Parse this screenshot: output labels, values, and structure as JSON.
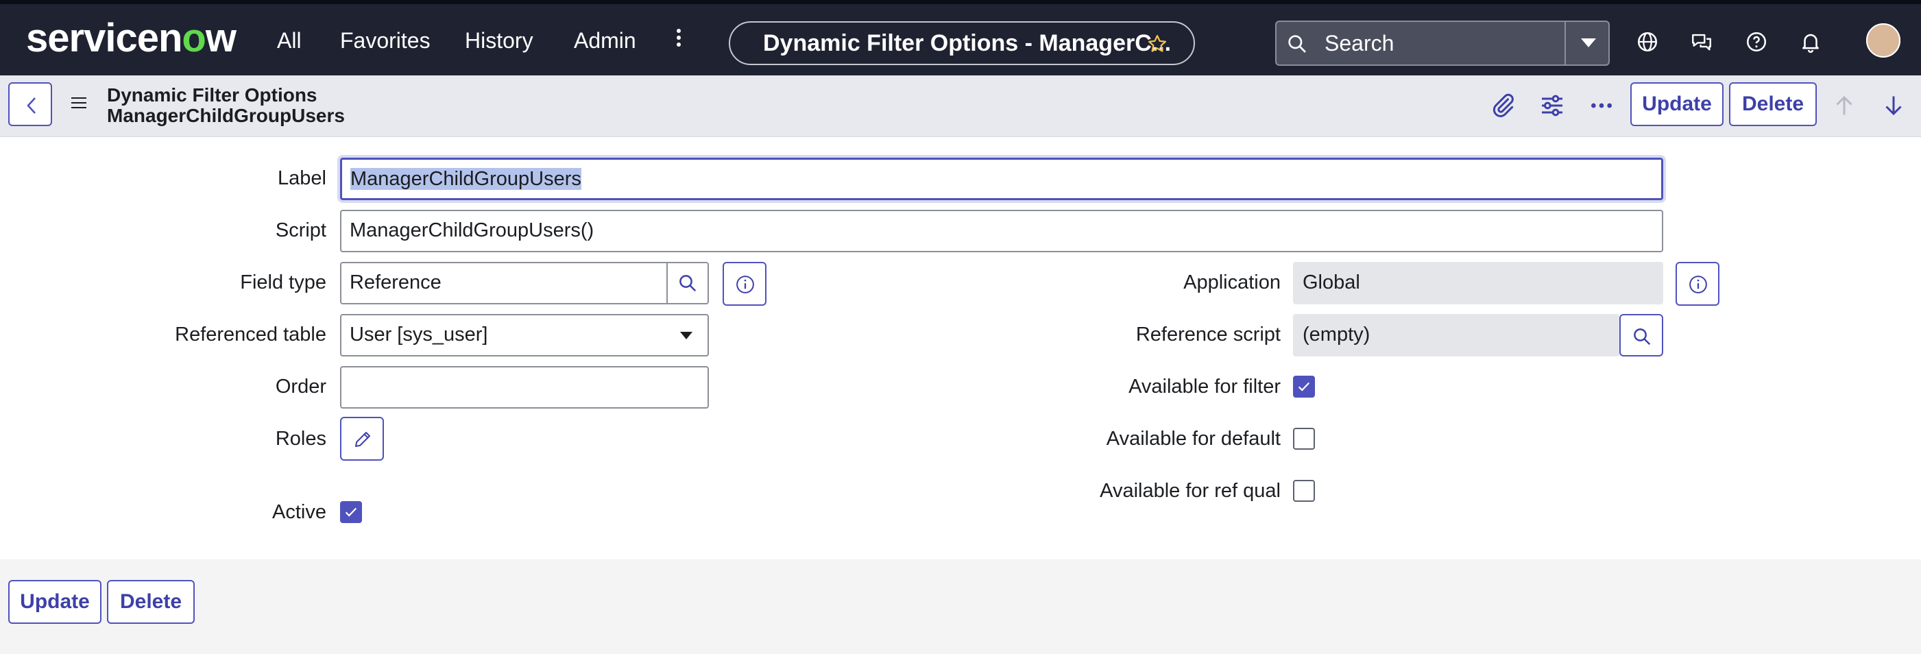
{
  "nav": {
    "logo": "servicenow",
    "links": [
      "All",
      "Favorites",
      "History",
      "Admin"
    ],
    "record_pill": "Dynamic Filter Options - ManagerC...",
    "search_placeholder": "Search"
  },
  "header": {
    "title_line1": "Dynamic Filter Options",
    "title_line2": "ManagerChildGroupUsers",
    "update_label": "Update",
    "delete_label": "Delete"
  },
  "form": {
    "label": {
      "label": "Label",
      "value": "ManagerChildGroupUsers"
    },
    "script": {
      "label": "Script",
      "value": "ManagerChildGroupUsers()"
    },
    "field_type": {
      "label": "Field type",
      "value": "Reference"
    },
    "referenced_table": {
      "label": "Referenced table",
      "value": "User [sys_user]"
    },
    "order": {
      "label": "Order",
      "value": ""
    },
    "roles": {
      "label": "Roles"
    },
    "active": {
      "label": "Active",
      "checked": true
    },
    "application": {
      "label": "Application",
      "value": "Global"
    },
    "reference_script": {
      "label": "Reference script",
      "value": "(empty)"
    },
    "available_for_filter": {
      "label": "Available for filter",
      "checked": true
    },
    "available_for_default": {
      "label": "Available for default",
      "checked": false
    },
    "available_for_ref_qual": {
      "label": "Available for ref qual",
      "checked": false
    }
  },
  "footer": {
    "update_label": "Update",
    "delete_label": "Delete"
  },
  "colors": {
    "nav_bg": "#1f2231",
    "accent": "#4f52bd",
    "logo_green": "#62d84e"
  }
}
